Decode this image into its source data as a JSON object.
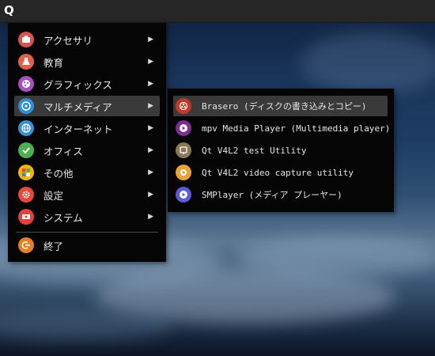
{
  "topbar": {
    "logo": "Q"
  },
  "colors": {
    "menu_bg": "#050505",
    "highlight": "#3a3a3a",
    "text": "#e6e6e6"
  },
  "menu": {
    "items": [
      {
        "label": "アクセサリ",
        "icon": "accessories-icon",
        "color": "#d9534f",
        "arrow": "▶"
      },
      {
        "label": "教育",
        "icon": "education-icon",
        "color": "#e0604a",
        "arrow": "▶"
      },
      {
        "label": "グラフィックス",
        "icon": "graphics-icon",
        "color": "#a94fc4",
        "arrow": "▶"
      },
      {
        "label": "マルチメディア",
        "icon": "multimedia-icon",
        "color": "#2f8fd6",
        "arrow": "▶"
      },
      {
        "label": "インターネット",
        "icon": "internet-icon",
        "color": "#3a8fd0",
        "arrow": "▶"
      },
      {
        "label": "オフィス",
        "icon": "office-icon",
        "color": "#4caf50",
        "arrow": "▶"
      },
      {
        "label": "その他",
        "icon": "other-icon",
        "color": "#f4b400",
        "arrow": "▶"
      },
      {
        "label": "設定",
        "icon": "settings-icon",
        "color": "#e5483c",
        "arrow": "▶"
      },
      {
        "label": "システム",
        "icon": "system-icon",
        "color": "#e0413a",
        "arrow": "▶"
      }
    ],
    "quit": {
      "label": "終了",
      "icon": "quit-icon",
      "color": "#e67e22"
    }
  },
  "submenu": {
    "items": [
      {
        "label": "Brasero (ディスクの書き込みとコピー)",
        "icon": "brasero-icon",
        "color": "#c0392b"
      },
      {
        "label": "mpv Media Player (Multimedia player)",
        "icon": "mpv-icon",
        "color": "#7b2f8f"
      },
      {
        "label": "Qt V4L2 test Utility",
        "icon": "qv4l2-icon",
        "color": "#8a7a5a"
      },
      {
        "label": "Qt V4L2 video capture utility",
        "icon": "qvidcap-icon",
        "color": "#e8a33b"
      },
      {
        "label": "SMPlayer (メディア プレーヤー)",
        "icon": "smplayer-icon",
        "color": "#5b5bd6"
      }
    ]
  }
}
